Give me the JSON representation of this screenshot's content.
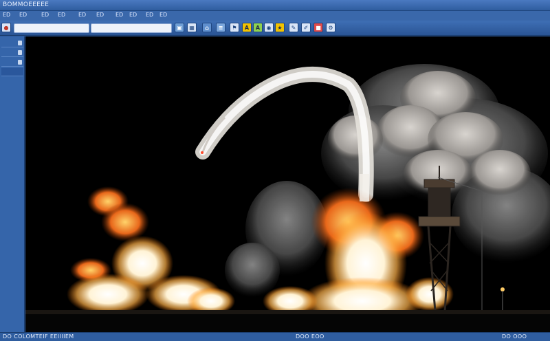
{
  "window": {
    "title": "BOMMOEEEEE"
  },
  "menubar": {
    "items": [
      "ED",
      "ED",
      "ED",
      "ED",
      "ED",
      "ED",
      "ED",
      "ED",
      "ED",
      "ED"
    ]
  },
  "toolbar": {
    "buttons": [
      "save-icon",
      "grid-icon",
      "home-icon",
      "image-icon",
      "flag-icon",
      "layers-icon",
      "text-icon",
      "text-icon",
      "camera-icon",
      "settings-icon"
    ],
    "accent_color": "#f2c200"
  },
  "statusbar": {
    "left_text": "DO COLOMTEIF EEIIIIEM",
    "mid_text": "DOO EOO",
    "right_text": "DO OOO"
  },
  "viewport": {
    "background": "#000000"
  }
}
